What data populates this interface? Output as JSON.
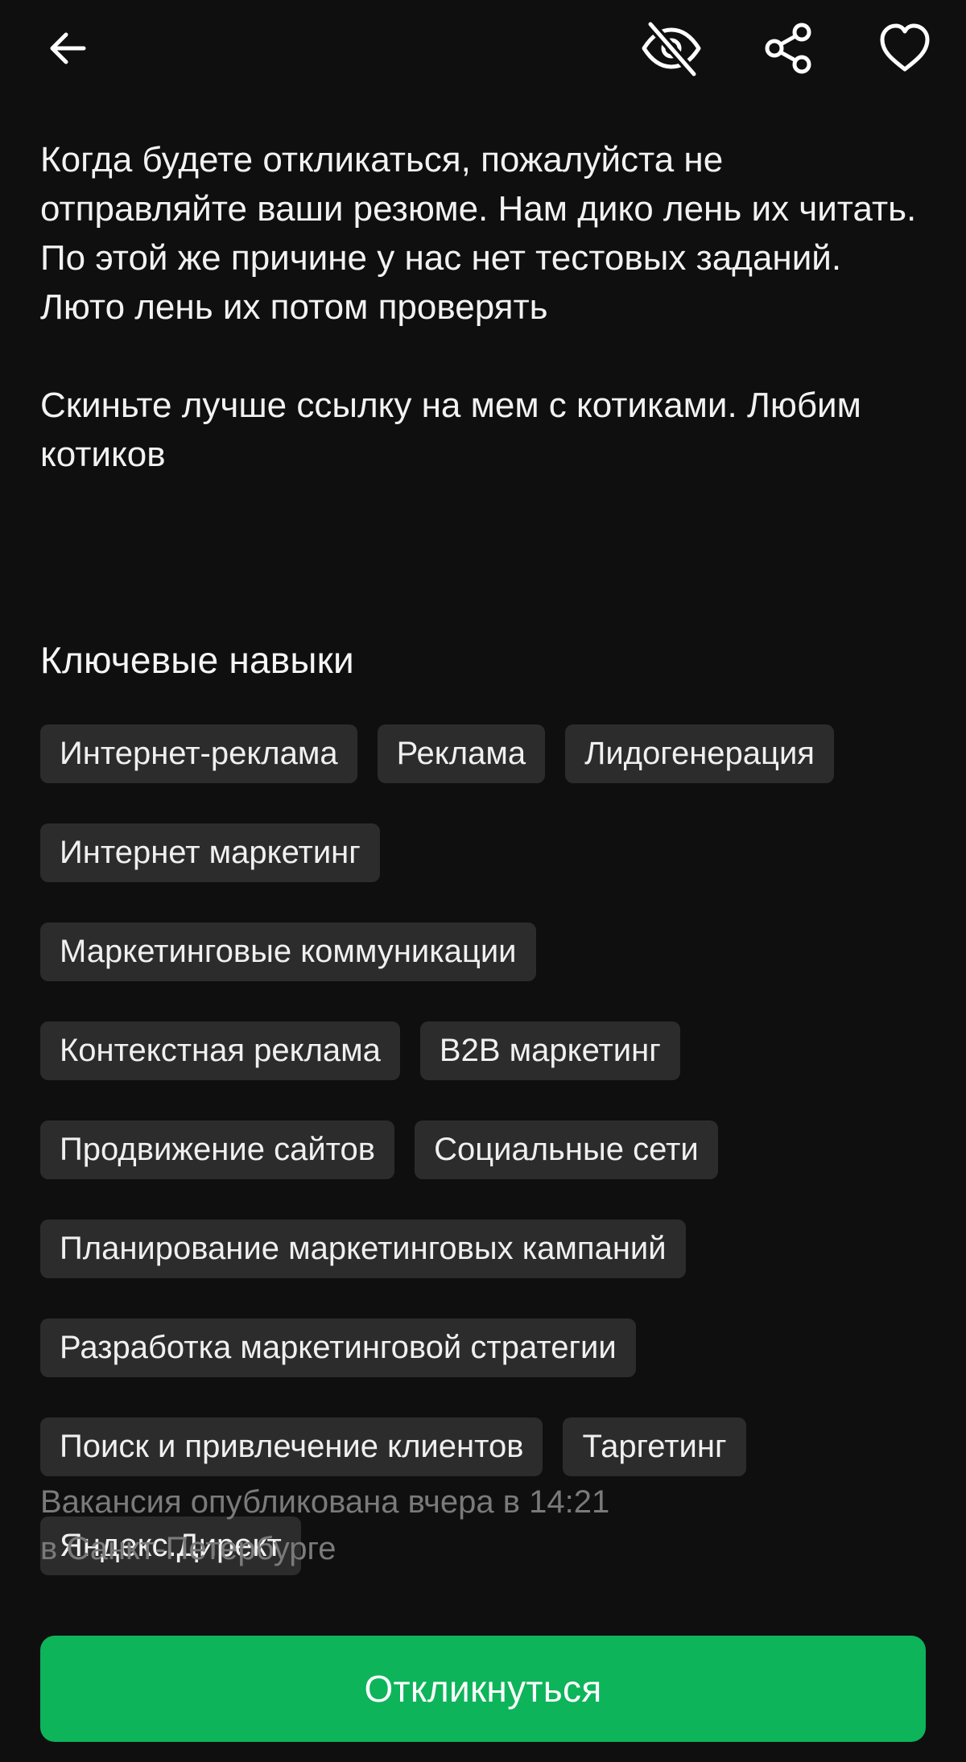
{
  "description": {
    "paragraph_1": "Когда будете откликаться, пожалуйста не отправляйте ваши резюме. Нам дико лень их читать. По этой же причине у нас нет тестовых заданий. Люто лень их потом проверять",
    "paragraph_2": "Скиньте лучше ссылку на мем с котиками. Любим котиков"
  },
  "skills": {
    "title": "Ключевые навыки",
    "items": [
      "Интернет-реклама",
      "Реклама",
      "Лидогенерация",
      "Интернет маркетинг",
      "Маркетинговые коммуникации",
      "Контекстная реклама",
      "B2B маркетинг",
      "Продвижение сайтов",
      "Социальные сети",
      "Планирование маркетинговых кампаний",
      "Разработка маркетинговой стратегии",
      "Поиск и привлечение клиентов",
      "Таргетинг",
      "Яндекс.Директ"
    ]
  },
  "published": {
    "line_1": "Вакансия опубликована вчера в 14:21",
    "line_2": "в Санкт-Петербурге"
  },
  "actions": {
    "respond_label": "Откликнуться"
  },
  "icons": {
    "back": "arrow-left-icon",
    "hide": "eye-off-icon",
    "share": "share-icon",
    "favorite": "heart-icon"
  },
  "colors": {
    "background": "#0f0f0f",
    "chip": "#2c2c2c",
    "accent": "#0db45a",
    "muted_text": "#7a7a7a"
  }
}
